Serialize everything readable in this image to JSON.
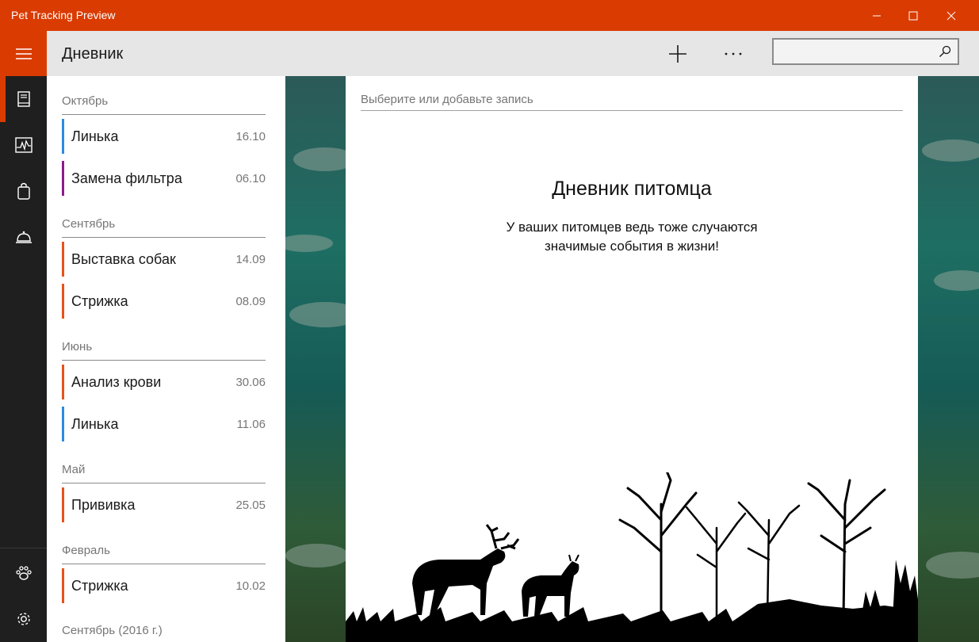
{
  "window": {
    "title": "Pet Tracking Preview",
    "accent_color": "#da3b01",
    "controls": [
      "minimize-icon",
      "maximize-icon",
      "close-icon"
    ]
  },
  "nav": {
    "items": [
      {
        "icon": "journal-icon",
        "selected": true
      },
      {
        "icon": "chart-icon",
        "selected": false
      },
      {
        "icon": "shopping-bag-icon",
        "selected": false
      },
      {
        "icon": "food-cloche-icon",
        "selected": false
      },
      {
        "icon": "paw-icon",
        "selected": false
      },
      {
        "icon": "settings-icon",
        "selected": false
      }
    ]
  },
  "header": {
    "title": "Дневник",
    "search_placeholder": "",
    "search_value": ""
  },
  "journal": {
    "groups": [
      {
        "label": "Октябрь",
        "entries": [
          {
            "name": "Линька",
            "date": "16.10",
            "color": "#2b8ae0"
          },
          {
            "name": "Замена фильтра",
            "date": "06.10",
            "color": "#8c1a8c"
          }
        ]
      },
      {
        "label": "Сентябрь",
        "entries": [
          {
            "name": "Выставка собак",
            "date": "14.09",
            "color": "#e8521a"
          },
          {
            "name": "Стрижка",
            "date": "08.09",
            "color": "#e8521a"
          }
        ]
      },
      {
        "label": "Июнь",
        "entries": [
          {
            "name": "Анализ крови",
            "date": "30.06",
            "color": "#e8521a"
          },
          {
            "name": "Линька",
            "date": "11.06",
            "color": "#2b8ae0"
          }
        ]
      },
      {
        "label": "Май",
        "entries": [
          {
            "name": "Прививка",
            "date": "25.05",
            "color": "#e8521a"
          }
        ]
      },
      {
        "label": "Февраль",
        "entries": [
          {
            "name": "Стрижка",
            "date": "10.02",
            "color": "#e8521a"
          }
        ]
      },
      {
        "label": "Сентябрь (2016 г.)",
        "entries": []
      }
    ]
  },
  "detail": {
    "placeholder": "Выберите или добавьте запись",
    "heading": "Дневник питомца",
    "subtext_line1": "У ваших питомцев ведь тоже случаются",
    "subtext_line2": "значимые события в жизни!"
  }
}
